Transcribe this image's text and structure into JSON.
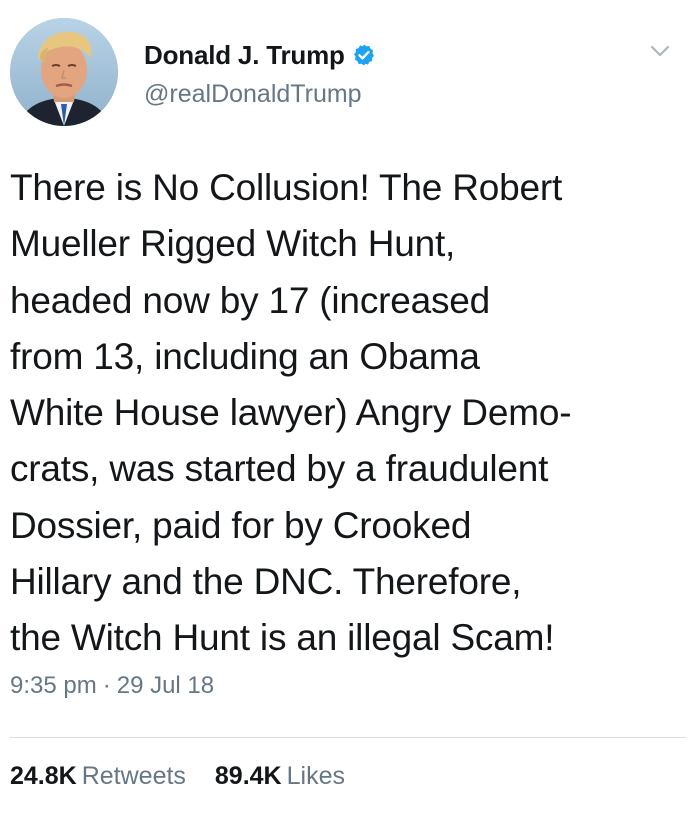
{
  "author": {
    "display_name": "Donald J. Trump",
    "handle": "@realDonaldTrump",
    "verified": true,
    "verified_color": "#1da1f2",
    "avatar_icon": "profile-photo"
  },
  "tweet": {
    "lines": [
      "There is No Collusion! The Robert",
      "Mueller Rigged Witch Hunt,",
      "headed now by 17 (increased",
      "from 13, including an Obama",
      "White House lawyer) Angry Demo-",
      "crats, was started by a fraudulent",
      "Dossier, paid for by Crooked",
      "Hillary and the DNC. Therefore,",
      "the Witch Hunt is an illegal Scam!"
    ],
    "time": "9:35 pm",
    "separator": "·",
    "date": "29 Jul 18"
  },
  "stats": {
    "retweets_count": "24.8K",
    "retweets_label": "Retweets",
    "likes_count": "89.4K",
    "likes_label": "Likes"
  },
  "colors": {
    "text": "#14171a",
    "secondary": "#657786",
    "divider": "#d7dde2",
    "chevron": "#aab8c2"
  }
}
